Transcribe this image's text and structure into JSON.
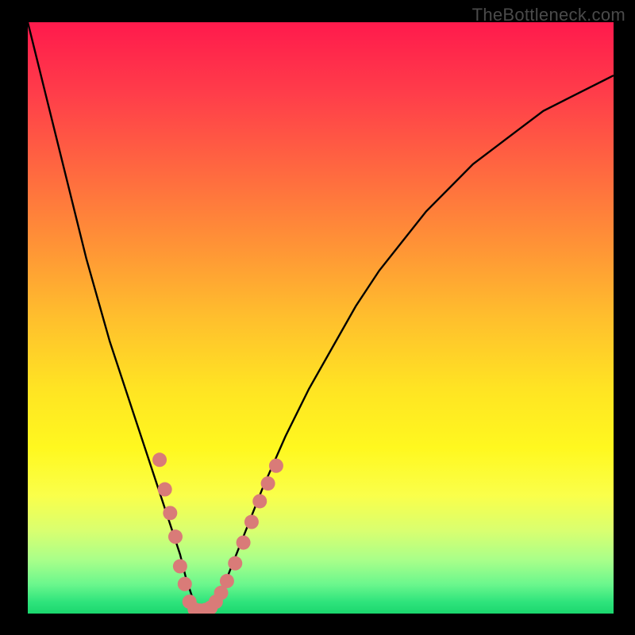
{
  "watermark": "TheBottleneck.com",
  "colors": {
    "curve_stroke": "#000000",
    "dot_fill": "#d97b78",
    "frame_bg": "#000000"
  },
  "chart_data": {
    "type": "line",
    "title": "",
    "xlabel": "",
    "ylabel": "",
    "xlim": [
      0,
      100
    ],
    "ylim": [
      0,
      100
    ],
    "series": [
      {
        "name": "bottleneck-curve",
        "x": [
          0,
          2,
          4,
          6,
          8,
          10,
          12,
          14,
          16,
          18,
          20,
          22,
          24,
          26,
          27,
          28,
          29,
          30,
          32,
          34,
          36,
          38,
          40,
          44,
          48,
          52,
          56,
          60,
          64,
          68,
          72,
          76,
          80,
          84,
          88,
          92,
          96,
          100
        ],
        "y": [
          100,
          92,
          84,
          76,
          68,
          60,
          53,
          46,
          40,
          34,
          28,
          22,
          16,
          10,
          6,
          3,
          1,
          0,
          2,
          6,
          11,
          16,
          21,
          30,
          38,
          45,
          52,
          58,
          63,
          68,
          72,
          76,
          79,
          82,
          85,
          87,
          89,
          91
        ]
      }
    ],
    "dots": {
      "name": "highlight-points",
      "points": [
        {
          "x": 22.5,
          "y": 26
        },
        {
          "x": 23.4,
          "y": 21
        },
        {
          "x": 24.3,
          "y": 17
        },
        {
          "x": 25.2,
          "y": 13
        },
        {
          "x": 26.0,
          "y": 8
        },
        {
          "x": 26.8,
          "y": 5
        },
        {
          "x": 27.6,
          "y": 2
        },
        {
          "x": 28.5,
          "y": 0.7
        },
        {
          "x": 29.4,
          "y": 0.5
        },
        {
          "x": 30.3,
          "y": 0.6
        },
        {
          "x": 31.2,
          "y": 1
        },
        {
          "x": 32.1,
          "y": 2
        },
        {
          "x": 33.0,
          "y": 3.5
        },
        {
          "x": 34.0,
          "y": 5.5
        },
        {
          "x": 35.4,
          "y": 8.5
        },
        {
          "x": 36.8,
          "y": 12
        },
        {
          "x": 38.2,
          "y": 15.5
        },
        {
          "x": 39.6,
          "y": 19
        },
        {
          "x": 41.0,
          "y": 22
        },
        {
          "x": 42.4,
          "y": 25
        }
      ]
    }
  }
}
